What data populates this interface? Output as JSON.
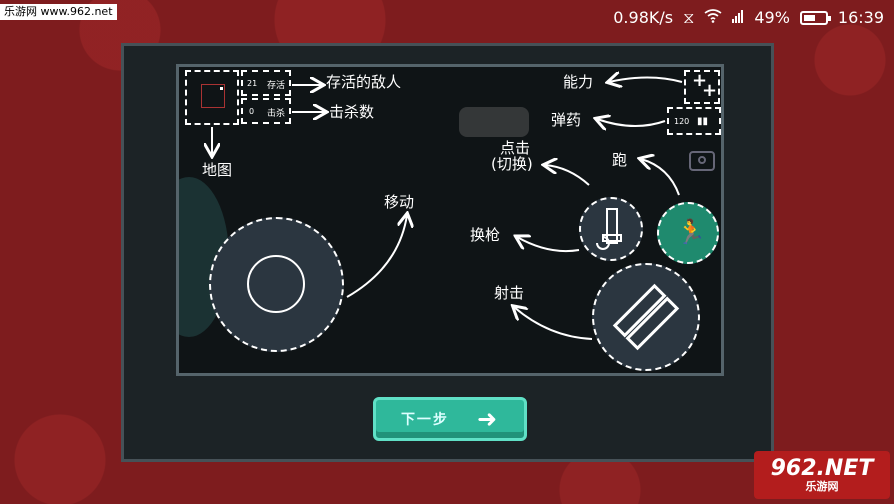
{
  "status_bar": {
    "watermark": "乐游网 www.962.net",
    "net_speed": "0.98K/s",
    "battery_pct": "49%",
    "time": "16:39"
  },
  "tutorial": {
    "labels": {
      "enemies_alive": "存活的敌人",
      "kills": "击杀数",
      "map": "地图",
      "move": "移动",
      "ability": "能力",
      "ammo": "弹药",
      "tap_switch_line1": "点击",
      "tap_switch_line2": "(切换)",
      "run": "跑",
      "switch_gun": "换枪",
      "shoot": "射击"
    },
    "hud": {
      "alive_count": "21",
      "alive_tag": "存活",
      "kill_count": "0",
      "kill_tag": "击杀",
      "ammo_count": "120"
    }
  },
  "next_button": {
    "label": "下一步",
    "icon": "arrow-right-icon"
  },
  "logo_watermark": {
    "big": "962.NET",
    "sub": "乐游网"
  },
  "colors": {
    "accent": "#2fb89b",
    "run_button": "#1f8a6e",
    "background": "#7e1c1e"
  }
}
